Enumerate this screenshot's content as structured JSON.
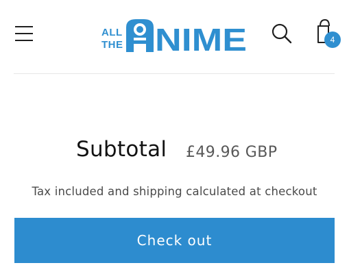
{
  "header": {
    "menu_icon": "hamburger-menu-icon",
    "logo": {
      "small_top": "ALL",
      "small_bottom": "THE",
      "big": "NIME",
      "color": "#2f8fd0"
    },
    "search_icon": "search-icon",
    "cart": {
      "icon": "shopping-bag-icon",
      "count": "4"
    }
  },
  "summary": {
    "subtotal_label": "Subtotal",
    "subtotal_value": "£49.96 GBP",
    "tax_note": "Tax included and shipping calculated at checkout"
  },
  "checkout": {
    "label": "Check out",
    "color": "#2d8ccf"
  }
}
